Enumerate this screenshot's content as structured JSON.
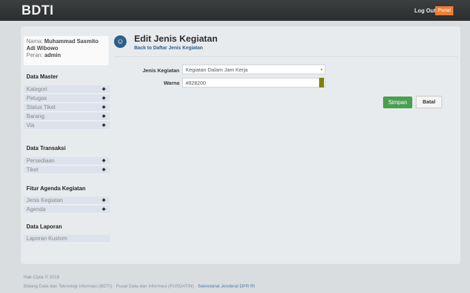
{
  "topbar": {
    "brand": "BDTI",
    "logout_label": "Log Out",
    "portal_label": "Portal"
  },
  "user": {
    "name_label": "Nama:",
    "name_value": "Muhammad Sasmito Adi Wibowo",
    "role_label": "Peran:",
    "role_value": "admin"
  },
  "sidebar": {
    "sections": [
      {
        "title": "Data Master",
        "items": [
          "Kategori",
          "Petugas",
          "Status Tiket",
          "Barang",
          "Via"
        ]
      },
      {
        "title": "Data Transaksi",
        "items": [
          "Persediaan",
          "Tiket"
        ]
      },
      {
        "title": "Fitur Agenda Kegiatan",
        "items": [
          "Jenis Kegiatan",
          "Agenda"
        ]
      },
      {
        "title": "Data Laporan",
        "items": [
          "Laporan Kustom"
        ]
      }
    ]
  },
  "page": {
    "title": "Edit Jenis Kegiatan",
    "back_link": "Back to Daftar Jenis Kegiatan"
  },
  "form": {
    "jenis_label": "Jenis Kegiatan",
    "jenis_value": "Kegiatan Dalam Jam Kerja",
    "warna_label": "Warna",
    "warna_value": "#828200",
    "warna_color": "#828200",
    "save_label": "Simpan",
    "cancel_label": "Batal"
  },
  "footer": {
    "copyright": "Hak Cipta © 2018",
    "org_text": "Bidang Data dan Teknologi Informasi (BDTI) · Pusat Data dan Informasi (PUSDATIN) ·",
    "org_link": "Sekretariat Jenderal DPR RI"
  },
  "colors": {
    "accent": "#2b5f8f",
    "save": "#4a9f52",
    "portal": "#f07d32"
  }
}
